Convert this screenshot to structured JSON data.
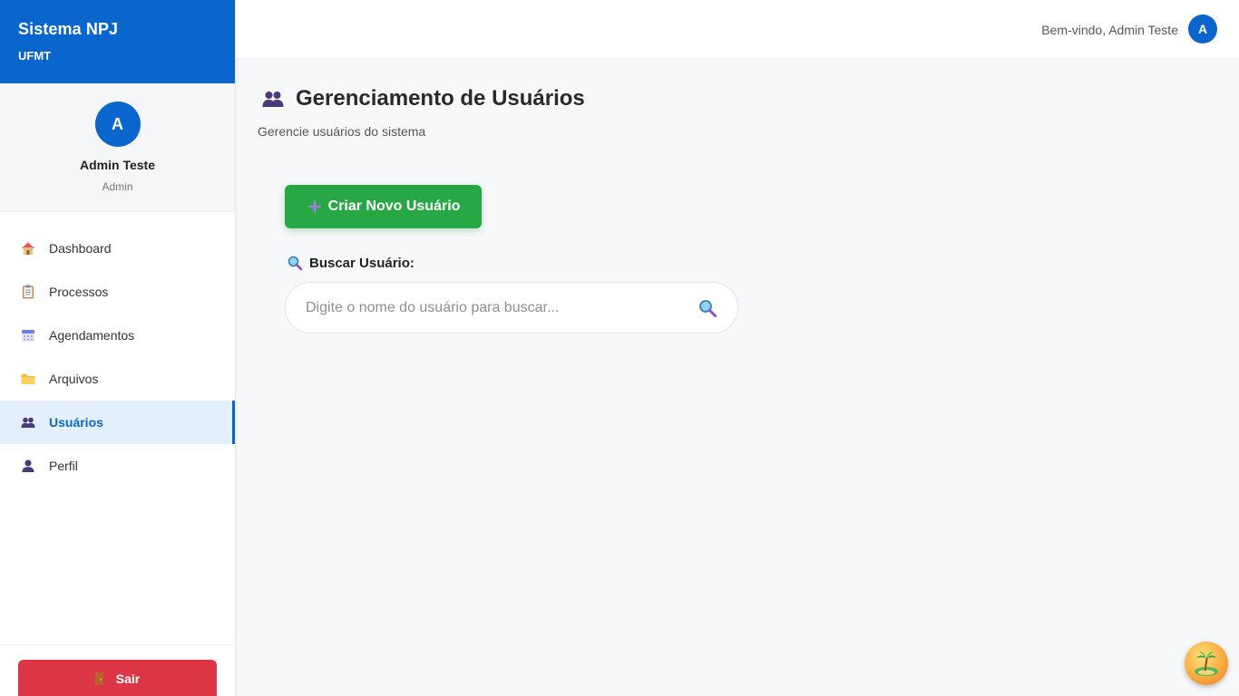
{
  "brand": {
    "title": "Sistema NPJ",
    "subtitle": "UFMT"
  },
  "profile": {
    "initial": "A",
    "name": "Admin Teste",
    "role": "Admin"
  },
  "nav": {
    "items": [
      {
        "label": "Dashboard",
        "icon": "house-icon"
      },
      {
        "label": "Processos",
        "icon": "clipboard-icon"
      },
      {
        "label": "Agendamentos",
        "icon": "calendar-icon"
      },
      {
        "label": "Arquivos",
        "icon": "folder-icon"
      },
      {
        "label": "Usuários",
        "icon": "users-icon",
        "active": true
      },
      {
        "label": "Perfil",
        "icon": "user-icon"
      }
    ]
  },
  "logout": {
    "label": "Sair",
    "icon": "door-icon"
  },
  "topbar": {
    "welcome": "Bem-vindo, Admin Teste",
    "avatar_initial": "A"
  },
  "page": {
    "title": "Gerenciamento de Usuários",
    "subtitle": "Gerencie usuários do sistema",
    "create_button": "Criar Novo Usuário",
    "search_label": "Buscar Usuário:",
    "search_placeholder": "Digite o nome do usuário para buscar..."
  },
  "colors": {
    "primary": "#0a66cc",
    "success": "#28a745",
    "danger": "#dc3545",
    "active_bg": "#e3effb"
  }
}
